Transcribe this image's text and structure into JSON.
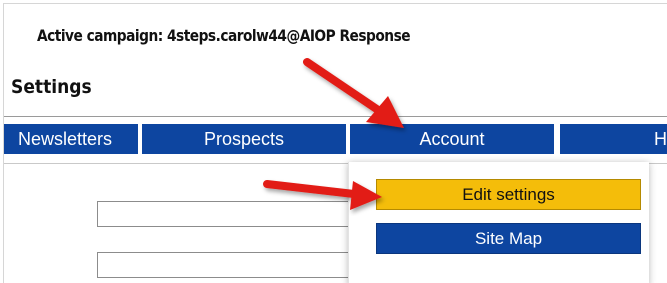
{
  "header": {
    "campaign_text": "Active campaign: 4steps.carolw44@AIOP Response",
    "page_title": "Settings"
  },
  "nav": {
    "tabs": [
      {
        "label": "Newsletters"
      },
      {
        "label": "Prospects"
      },
      {
        "label": "Account"
      },
      {
        "label": "Help"
      }
    ]
  },
  "account_menu": {
    "items": [
      {
        "label": "Edit settings"
      },
      {
        "label": "Site Map"
      }
    ]
  },
  "colors": {
    "nav_blue": "#0d45a0",
    "highlight_yellow": "#f4bd0a",
    "annotation_red": "#e21b14"
  }
}
